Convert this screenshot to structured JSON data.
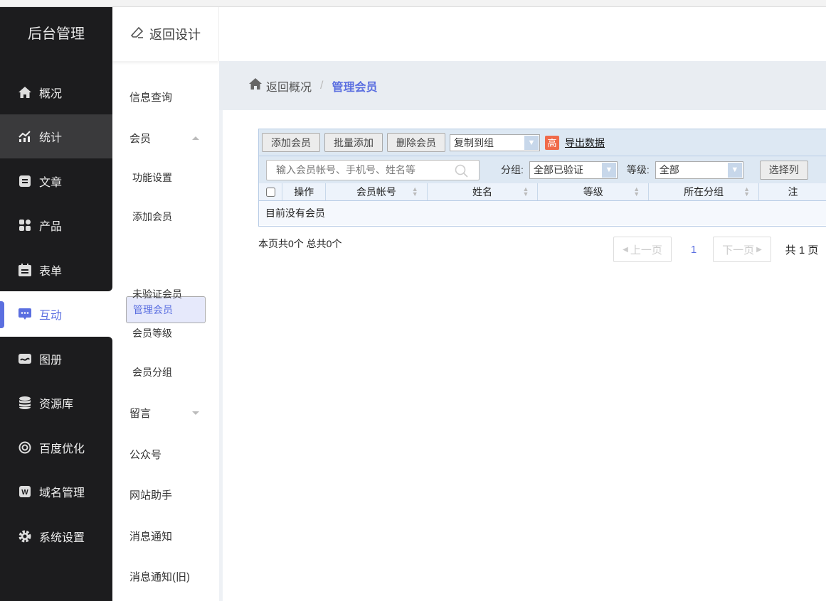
{
  "sidebar": {
    "title": "后台管理",
    "items": [
      {
        "label": "概况",
        "icon": "home-icon"
      },
      {
        "label": "统计",
        "icon": "chart-icon"
      },
      {
        "label": "文章",
        "icon": "article-icon"
      },
      {
        "label": "产品",
        "icon": "product-icon"
      },
      {
        "label": "表单",
        "icon": "form-icon"
      },
      {
        "label": "互动",
        "icon": "chat-icon"
      },
      {
        "label": "图册",
        "icon": "album-icon"
      },
      {
        "label": "资源库",
        "icon": "database-icon"
      },
      {
        "label": "百度优化",
        "icon": "seo-icon"
      },
      {
        "label": "域名管理",
        "icon": "domain-icon"
      },
      {
        "label": "系统设置",
        "icon": "gear-icon"
      }
    ],
    "active": "互动"
  },
  "subnav": {
    "back_label": "返回设计",
    "items": [
      "信息查询",
      "会员",
      "功能设置",
      "添加会员",
      "管理会员",
      "未验证会员",
      "会员等级",
      "会员分组",
      "留言",
      "公众号",
      "网站助手",
      "消息通知",
      "消息通知(旧)"
    ]
  },
  "breadcrumb": {
    "home": "返回概况",
    "current": "管理会员"
  },
  "toolbar": {
    "add": "添加会员",
    "batch_add": "批量添加",
    "delete": "删除会员",
    "copy_to_group": "复制到组",
    "badge": "高",
    "export": "导出数据"
  },
  "filter": {
    "search_placeholder": "输入会员帐号、手机号、姓名等",
    "group_label": "分组:",
    "group_value": "全部已验证",
    "level_label": "等级:",
    "level_value": "全部",
    "choose_cols": "选择列"
  },
  "table": {
    "columns": [
      "操作",
      "会员帐号",
      "姓名",
      "等级",
      "所在分组",
      "注"
    ],
    "empty": "目前没有会员"
  },
  "pagination": {
    "summary": "本页共0个 总共0个",
    "prev": "上一页",
    "current": "1",
    "next": "下一页",
    "total": "共 1 页"
  },
  "colors": {
    "accent": "#5b6fe0",
    "sidebar": "#1c1c1e"
  }
}
